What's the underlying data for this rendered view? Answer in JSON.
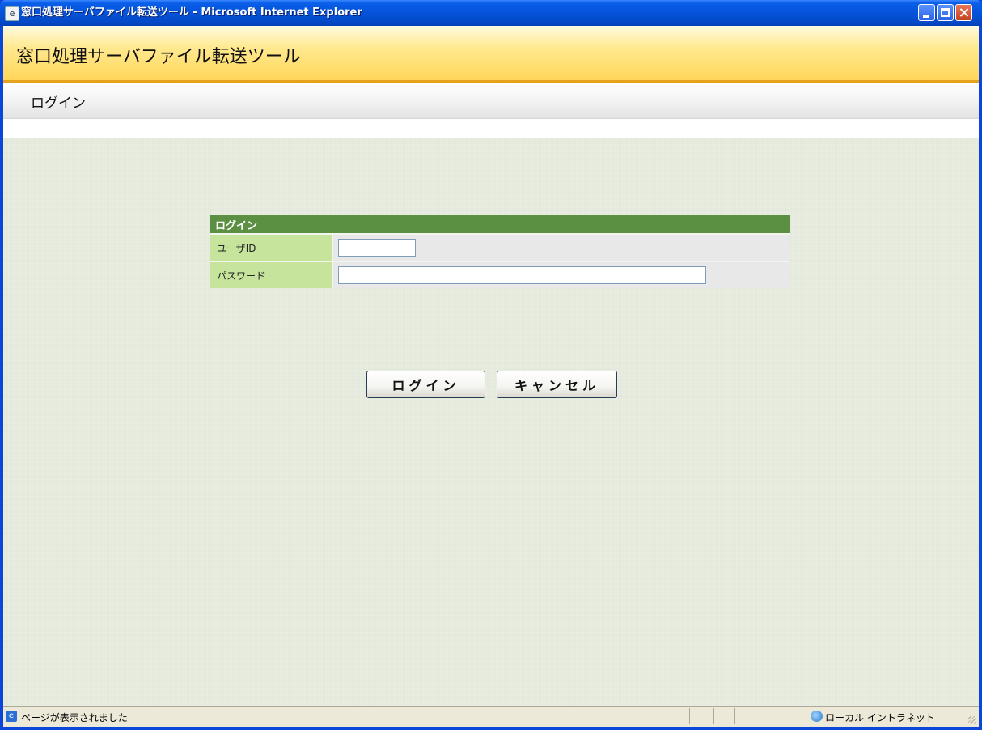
{
  "window": {
    "title": "窓口処理サーバファイル転送ツール - Microsoft Internet Explorer"
  },
  "app": {
    "title": "窓口処理サーバファイル転送ツール",
    "page_title": "ログイン"
  },
  "form": {
    "header": "ログイン",
    "user_id_label": "ユーザID",
    "user_id_value": "",
    "password_label": "パスワード",
    "password_value": ""
  },
  "buttons": {
    "login": "ログイン",
    "cancel": "キャンセル"
  },
  "statusbar": {
    "status_text": "ページが表示されました",
    "zone_text": "ローカル イントラネット"
  },
  "colors": {
    "header_yellow": "#ffd65a",
    "form_header_green": "#5b9043",
    "label_green": "#c6e49c",
    "xp_title_blue": "#0553d9"
  }
}
